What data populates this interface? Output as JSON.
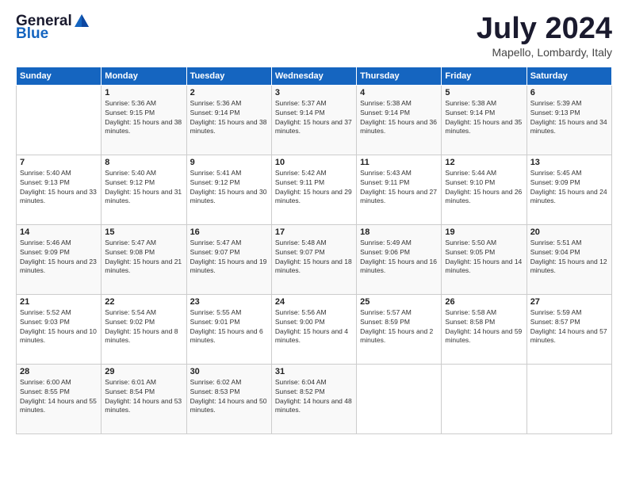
{
  "header": {
    "logo_general": "General",
    "logo_blue": "Blue",
    "month_title": "July 2024",
    "location": "Mapello, Lombardy, Italy"
  },
  "weekdays": [
    "Sunday",
    "Monday",
    "Tuesday",
    "Wednesday",
    "Thursday",
    "Friday",
    "Saturday"
  ],
  "weeks": [
    [
      {
        "day": "",
        "sunrise": "",
        "sunset": "",
        "daylight": ""
      },
      {
        "day": "1",
        "sunrise": "Sunrise: 5:36 AM",
        "sunset": "Sunset: 9:15 PM",
        "daylight": "Daylight: 15 hours and 38 minutes."
      },
      {
        "day": "2",
        "sunrise": "Sunrise: 5:36 AM",
        "sunset": "Sunset: 9:14 PM",
        "daylight": "Daylight: 15 hours and 38 minutes."
      },
      {
        "day": "3",
        "sunrise": "Sunrise: 5:37 AM",
        "sunset": "Sunset: 9:14 PM",
        "daylight": "Daylight: 15 hours and 37 minutes."
      },
      {
        "day": "4",
        "sunrise": "Sunrise: 5:38 AM",
        "sunset": "Sunset: 9:14 PM",
        "daylight": "Daylight: 15 hours and 36 minutes."
      },
      {
        "day": "5",
        "sunrise": "Sunrise: 5:38 AM",
        "sunset": "Sunset: 9:14 PM",
        "daylight": "Daylight: 15 hours and 35 minutes."
      },
      {
        "day": "6",
        "sunrise": "Sunrise: 5:39 AM",
        "sunset": "Sunset: 9:13 PM",
        "daylight": "Daylight: 15 hours and 34 minutes."
      }
    ],
    [
      {
        "day": "7",
        "sunrise": "Sunrise: 5:40 AM",
        "sunset": "Sunset: 9:13 PM",
        "daylight": "Daylight: 15 hours and 33 minutes."
      },
      {
        "day": "8",
        "sunrise": "Sunrise: 5:40 AM",
        "sunset": "Sunset: 9:12 PM",
        "daylight": "Daylight: 15 hours and 31 minutes."
      },
      {
        "day": "9",
        "sunrise": "Sunrise: 5:41 AM",
        "sunset": "Sunset: 9:12 PM",
        "daylight": "Daylight: 15 hours and 30 minutes."
      },
      {
        "day": "10",
        "sunrise": "Sunrise: 5:42 AM",
        "sunset": "Sunset: 9:11 PM",
        "daylight": "Daylight: 15 hours and 29 minutes."
      },
      {
        "day": "11",
        "sunrise": "Sunrise: 5:43 AM",
        "sunset": "Sunset: 9:11 PM",
        "daylight": "Daylight: 15 hours and 27 minutes."
      },
      {
        "day": "12",
        "sunrise": "Sunrise: 5:44 AM",
        "sunset": "Sunset: 9:10 PM",
        "daylight": "Daylight: 15 hours and 26 minutes."
      },
      {
        "day": "13",
        "sunrise": "Sunrise: 5:45 AM",
        "sunset": "Sunset: 9:09 PM",
        "daylight": "Daylight: 15 hours and 24 minutes."
      }
    ],
    [
      {
        "day": "14",
        "sunrise": "Sunrise: 5:46 AM",
        "sunset": "Sunset: 9:09 PM",
        "daylight": "Daylight: 15 hours and 23 minutes."
      },
      {
        "day": "15",
        "sunrise": "Sunrise: 5:47 AM",
        "sunset": "Sunset: 9:08 PM",
        "daylight": "Daylight: 15 hours and 21 minutes."
      },
      {
        "day": "16",
        "sunrise": "Sunrise: 5:47 AM",
        "sunset": "Sunset: 9:07 PM",
        "daylight": "Daylight: 15 hours and 19 minutes."
      },
      {
        "day": "17",
        "sunrise": "Sunrise: 5:48 AM",
        "sunset": "Sunset: 9:07 PM",
        "daylight": "Daylight: 15 hours and 18 minutes."
      },
      {
        "day": "18",
        "sunrise": "Sunrise: 5:49 AM",
        "sunset": "Sunset: 9:06 PM",
        "daylight": "Daylight: 15 hours and 16 minutes."
      },
      {
        "day": "19",
        "sunrise": "Sunrise: 5:50 AM",
        "sunset": "Sunset: 9:05 PM",
        "daylight": "Daylight: 15 hours and 14 minutes."
      },
      {
        "day": "20",
        "sunrise": "Sunrise: 5:51 AM",
        "sunset": "Sunset: 9:04 PM",
        "daylight": "Daylight: 15 hours and 12 minutes."
      }
    ],
    [
      {
        "day": "21",
        "sunrise": "Sunrise: 5:52 AM",
        "sunset": "Sunset: 9:03 PM",
        "daylight": "Daylight: 15 hours and 10 minutes."
      },
      {
        "day": "22",
        "sunrise": "Sunrise: 5:54 AM",
        "sunset": "Sunset: 9:02 PM",
        "daylight": "Daylight: 15 hours and 8 minutes."
      },
      {
        "day": "23",
        "sunrise": "Sunrise: 5:55 AM",
        "sunset": "Sunset: 9:01 PM",
        "daylight": "Daylight: 15 hours and 6 minutes."
      },
      {
        "day": "24",
        "sunrise": "Sunrise: 5:56 AM",
        "sunset": "Sunset: 9:00 PM",
        "daylight": "Daylight: 15 hours and 4 minutes."
      },
      {
        "day": "25",
        "sunrise": "Sunrise: 5:57 AM",
        "sunset": "Sunset: 8:59 PM",
        "daylight": "Daylight: 15 hours and 2 minutes."
      },
      {
        "day": "26",
        "sunrise": "Sunrise: 5:58 AM",
        "sunset": "Sunset: 8:58 PM",
        "daylight": "Daylight: 14 hours and 59 minutes."
      },
      {
        "day": "27",
        "sunrise": "Sunrise: 5:59 AM",
        "sunset": "Sunset: 8:57 PM",
        "daylight": "Daylight: 14 hours and 57 minutes."
      }
    ],
    [
      {
        "day": "28",
        "sunrise": "Sunrise: 6:00 AM",
        "sunset": "Sunset: 8:55 PM",
        "daylight": "Daylight: 14 hours and 55 minutes."
      },
      {
        "day": "29",
        "sunrise": "Sunrise: 6:01 AM",
        "sunset": "Sunset: 8:54 PM",
        "daylight": "Daylight: 14 hours and 53 minutes."
      },
      {
        "day": "30",
        "sunrise": "Sunrise: 6:02 AM",
        "sunset": "Sunset: 8:53 PM",
        "daylight": "Daylight: 14 hours and 50 minutes."
      },
      {
        "day": "31",
        "sunrise": "Sunrise: 6:04 AM",
        "sunset": "Sunset: 8:52 PM",
        "daylight": "Daylight: 14 hours and 48 minutes."
      },
      {
        "day": "",
        "sunrise": "",
        "sunset": "",
        "daylight": ""
      },
      {
        "day": "",
        "sunrise": "",
        "sunset": "",
        "daylight": ""
      },
      {
        "day": "",
        "sunrise": "",
        "sunset": "",
        "daylight": ""
      }
    ]
  ]
}
